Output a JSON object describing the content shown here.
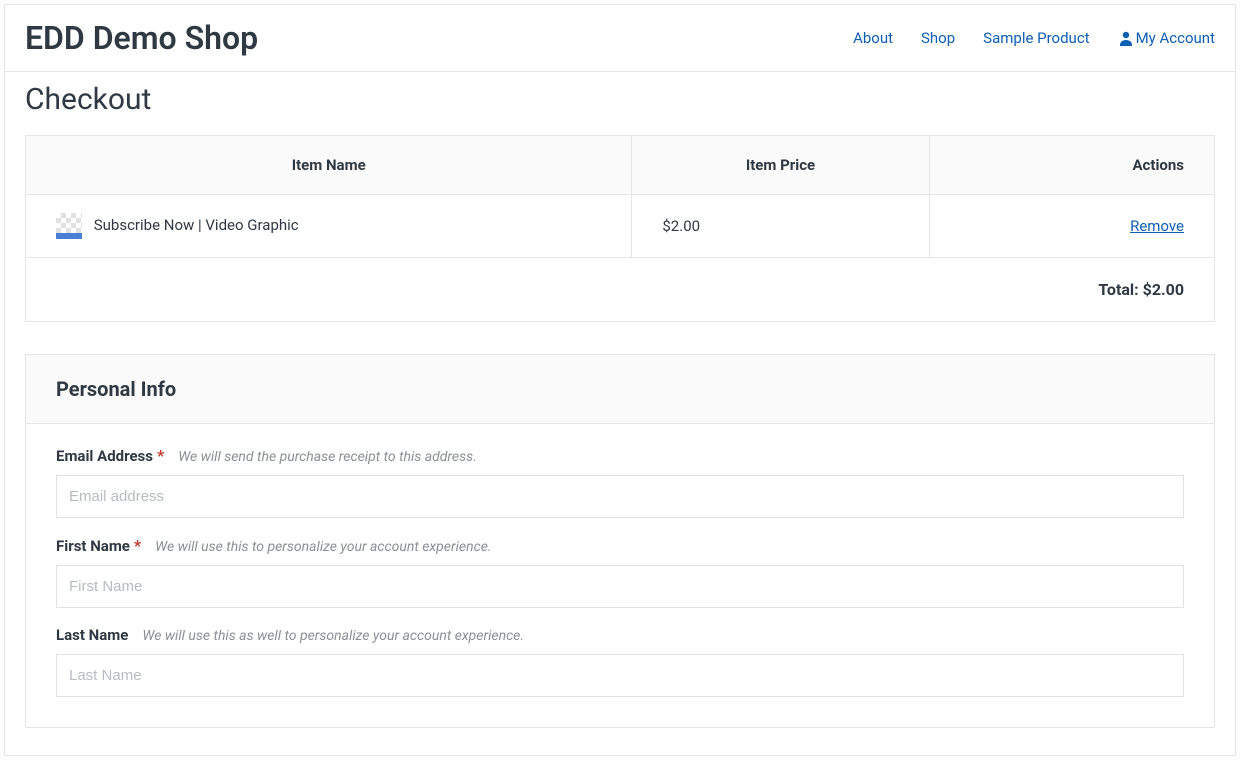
{
  "site": {
    "title": "EDD Demo Shop"
  },
  "nav": {
    "about": "About",
    "shop": "Shop",
    "sample_product": "Sample Product",
    "my_account": "My Account"
  },
  "page": {
    "title": "Checkout"
  },
  "cart": {
    "columns": {
      "name": "Item Name",
      "price": "Item Price",
      "actions": "Actions"
    },
    "items": [
      {
        "name": "Subscribe Now | Video Graphic",
        "price": "$2.00",
        "remove_label": "Remove"
      }
    ],
    "total_label": "Total: ",
    "total_value": "$2.00"
  },
  "personal_info": {
    "heading": "Personal Info",
    "email": {
      "label": "Email Address",
      "required_marker": "*",
      "hint": "We will send the purchase receipt to this address.",
      "placeholder": "Email address"
    },
    "first_name": {
      "label": "First Name",
      "required_marker": "*",
      "hint": "We will use this to personalize your account experience.",
      "placeholder": "First Name"
    },
    "last_name": {
      "label": "Last Name",
      "hint": "We will use this as well to personalize your account experience.",
      "placeholder": "Last Name"
    }
  }
}
